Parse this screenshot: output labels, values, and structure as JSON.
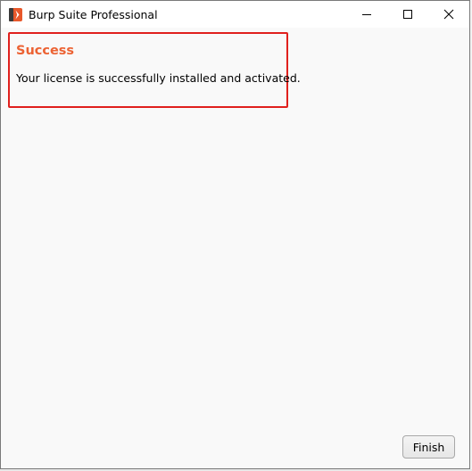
{
  "window": {
    "title": "Burp Suite Professional",
    "app_icon": "burp-suite-icon",
    "controls": {
      "minimize_icon": "minimize-icon",
      "maximize_icon": "maximize-icon",
      "close_icon": "close-icon"
    }
  },
  "message": {
    "title": "Success",
    "body": "Your license is successfully installed and activated.",
    "title_color": "#ec6233",
    "highlight_border_color": "#e0201d"
  },
  "footer": {
    "finish_label": "Finish"
  },
  "colors": {
    "brand_orange": "#e8582b",
    "background": "#f9f9f9"
  }
}
